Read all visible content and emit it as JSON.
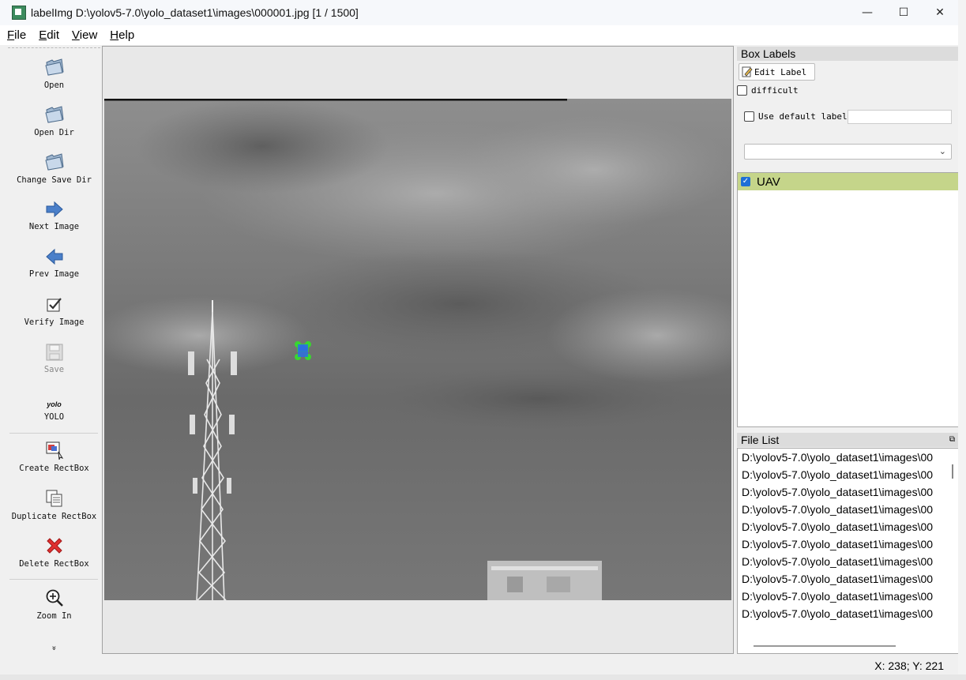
{
  "window": {
    "title": "labelImg D:\\yolov5-7.0\\yolo_dataset1\\images\\000001.jpg [1 / 1500]",
    "minimize": "—",
    "maximize": "☐",
    "close": "✕"
  },
  "menu": {
    "items": [
      {
        "label": "File",
        "key": "F",
        "rest": "ile"
      },
      {
        "label": "Edit",
        "key": "E",
        "rest": "dit"
      },
      {
        "label": "View",
        "key": "V",
        "rest": "iew"
      },
      {
        "label": "Help",
        "key": "H",
        "rest": "elp"
      }
    ]
  },
  "toolbar": {
    "open": "Open",
    "open_dir": "Open Dir",
    "change_save_dir": "Change Save Dir",
    "next_image": "Next Image",
    "prev_image": "Prev Image",
    "verify_image": "Verify Image",
    "save": "Save",
    "yolo_icon_text": "yolo",
    "yolo": "YOLO",
    "create_rectbox": "Create RectBox",
    "duplicate_rectbox": "Duplicate RectBox",
    "delete_rectbox": "Delete RectBox",
    "zoom_in": "Zoom In",
    "more": "»"
  },
  "box_labels": {
    "title": "Box Labels",
    "edit_label": "Edit Label",
    "difficult": "difficult",
    "use_default_label": "Use default label",
    "default_label_value": "",
    "combo_value": "",
    "labels": [
      {
        "name": "UAV",
        "checked": true
      }
    ]
  },
  "file_list": {
    "title": "File List",
    "items": [
      "D:\\yolov5-7.0\\yolo_dataset1\\images\\00",
      "D:\\yolov5-7.0\\yolo_dataset1\\images\\00",
      "D:\\yolov5-7.0\\yolo_dataset1\\images\\00",
      "D:\\yolov5-7.0\\yolo_dataset1\\images\\00",
      "D:\\yolov5-7.0\\yolo_dataset1\\images\\00",
      "D:\\yolov5-7.0\\yolo_dataset1\\images\\00",
      "D:\\yolov5-7.0\\yolo_dataset1\\images\\00",
      "D:\\yolov5-7.0\\yolo_dataset1\\images\\00",
      "D:\\yolov5-7.0\\yolo_dataset1\\images\\00",
      "D:\\yolov5-7.0\\yolo_dataset1\\images\\00"
    ]
  },
  "status": {
    "coords": "X: 238; Y: 221"
  },
  "colors": {
    "label_highlight": "#c5d58a",
    "box_fill": "#2d6ee0",
    "box_handles": "#39d630",
    "arrow_blue": "#4a7fc9",
    "delete_red": "#e03030"
  }
}
